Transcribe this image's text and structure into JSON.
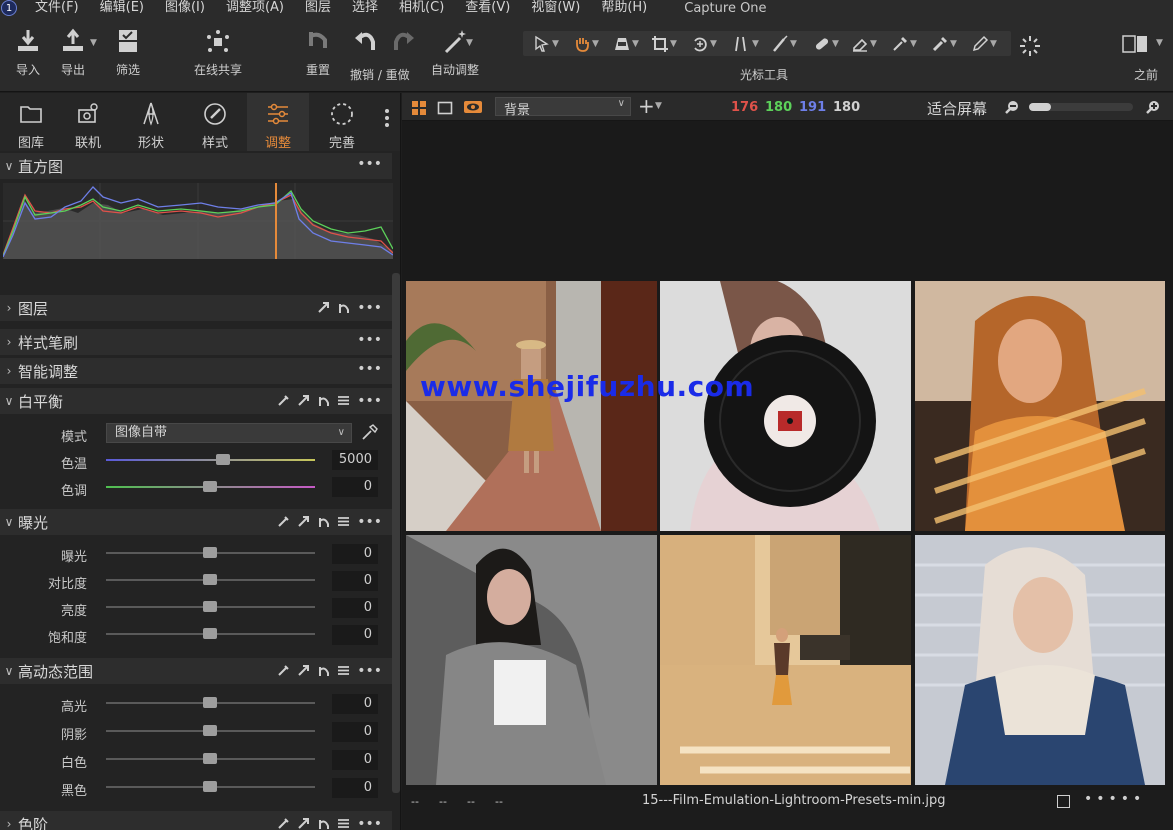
{
  "menubar": {
    "logo": "1",
    "items": [
      "文件(F)",
      "编辑(E)",
      "图像(I)",
      "调整项(A)",
      "图层",
      "选择",
      "相机(C)",
      "查看(V)",
      "视窗(W)",
      "帮助(H)"
    ],
    "app_title": "Capture One"
  },
  "toolbar": {
    "import": "导入",
    "export": "导出",
    "filter": "筛选",
    "share": "在线共享",
    "reset": "重置",
    "undo_redo": "撤销 / 重做",
    "auto_adjust": "自动调整",
    "cursor_tools": "光标工具",
    "before": "之前"
  },
  "tabs": [
    "图库",
    "联机",
    "形状",
    "样式",
    "调整",
    "完善"
  ],
  "active_tab": "调整",
  "sections": {
    "histogram": "直方图",
    "layers": "图层",
    "style_brush": "样式笔刷",
    "smart_adjust": "智能调整",
    "white_balance": "白平衡",
    "exposure": "曝光",
    "hdr": "高动态范围",
    "levels": "色阶"
  },
  "histogram_footer": [
    "--",
    "--",
    "--"
  ],
  "white_balance": {
    "mode_label": "模式",
    "mode_value": "图像自带",
    "temp_label": "色温",
    "temp_value": "5000",
    "tint_label": "色调",
    "tint_value": "0"
  },
  "exposure": {
    "exposure_label": "曝光",
    "exposure_value": "0",
    "contrast_label": "对比度",
    "contrast_value": "0",
    "brightness_label": "亮度",
    "brightness_value": "0",
    "saturation_label": "饱和度",
    "saturation_value": "0"
  },
  "hdr": {
    "highlight_label": "高光",
    "highlight_value": "0",
    "shadow_label": "阴影",
    "shadow_value": "0",
    "white_label": "白色",
    "white_value": "0",
    "black_label": "黑色",
    "black_value": "0"
  },
  "viewer": {
    "background_select": "背景",
    "rgb": {
      "r": "176",
      "g": "180",
      "b": "191",
      "l": "180"
    },
    "fit_label": "适合屏幕",
    "watermark": "www.shejifuzhu.com",
    "footer_dashes": [
      "--",
      "--",
      "--",
      "--"
    ],
    "filename": "15---Film-Emulation-Lightroom-Presets-min.jpg"
  },
  "colors": {
    "accent_orange": "#e58a3a",
    "rgb_red": "#e0524a",
    "rgb_green": "#5cd15a",
    "rgb_blue": "#6e7fe8",
    "watermark_blue": "#1a2be8"
  }
}
